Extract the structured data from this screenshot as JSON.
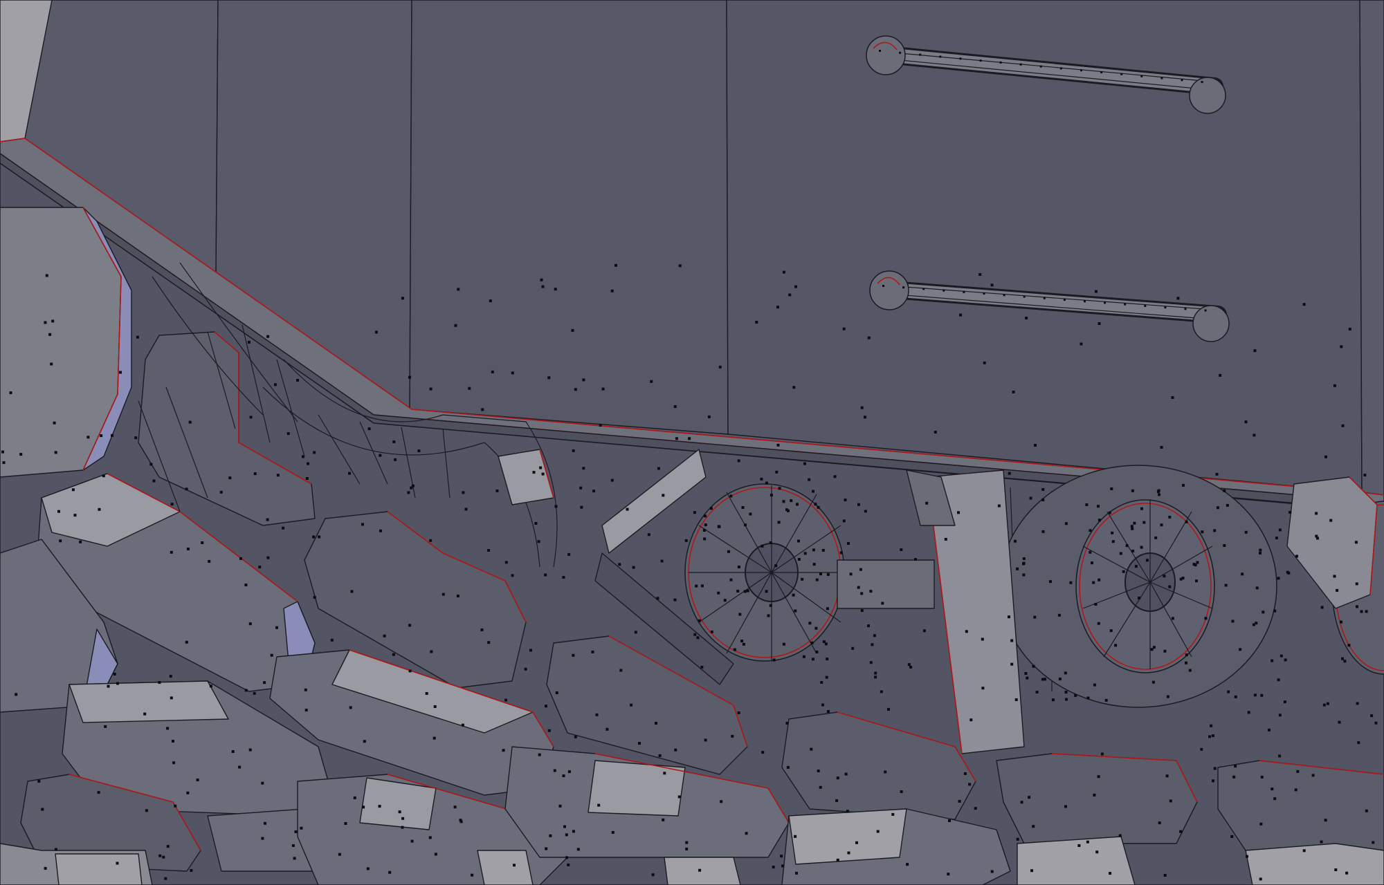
{
  "view": {
    "kind": "3d-viewport-edit-mode",
    "subject": "tracked-vehicle-mesh",
    "display": "solid-with-wireframe-overlay"
  },
  "colors": {
    "background": "#575868",
    "hull_face": "#585a69",
    "face_dark": "#4e505e",
    "face_mid": "#6a6c78",
    "face_light": "#9c9ca4",
    "face_blue": "#8a8db8",
    "wire_edge": "#1a1a22",
    "seam_edge": "#b01818",
    "vertex_dot": "#0c0c10"
  },
  "objects": {
    "handles": 2,
    "road_wheels": 2,
    "track_links": 24
  }
}
